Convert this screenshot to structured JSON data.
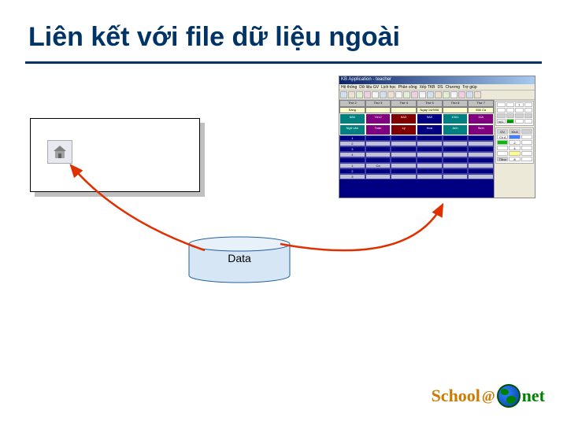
{
  "title": "Liên kết với file dữ liệu ngoài",
  "panel": {
    "icon_name": "house-icon"
  },
  "app_window": {
    "titlebar": "KB Application - teacher",
    "menu": [
      "Hệ thống",
      "Dữ liệu GV",
      "Lịch học",
      "Phân công",
      "Xếp TKB",
      "DS",
      "Chương",
      "Trợ giúp"
    ],
    "toolbar_count": 18,
    "grid": {
      "header": [
        "Thứ 2",
        "Thứ 3",
        "Thứ 4",
        "Thứ 5",
        "Thứ 6",
        "Thứ 7"
      ],
      "info": [
        "Sáng",
        "",
        "",
        "Ngày 14/9/06",
        "",
        "555 Ca"
      ],
      "colored_row1": [
        {
          "text": "6A6",
          "cls": "teal"
        },
        {
          "text": "7A12",
          "cls": "purple"
        },
        {
          "text": "8A3",
          "cls": "darkred"
        },
        {
          "text": "9A5",
          "cls": "darkblue"
        },
        {
          "text": "10A1",
          "cls": "teal"
        },
        {
          "text": "11A",
          "cls": "purple"
        }
      ],
      "colored_row2": [
        {
          "text": "Ngữ văn",
          "cls": "teal"
        },
        {
          "text": "Toán",
          "cls": "purple"
        },
        {
          "text": "Lý",
          "cls": "darkred"
        },
        {
          "text": "Hoá",
          "cls": "darkblue"
        },
        {
          "text": "Anh",
          "cls": "teal"
        },
        {
          "text": "Sinh",
          "cls": "purple"
        }
      ],
      "data_rows": [
        [
          "1",
          "",
          "",
          "",
          "",
          ""
        ],
        [
          "2",
          "",
          "",
          "",
          "",
          ""
        ],
        [
          "3",
          "",
          "",
          "",
          "",
          ""
        ],
        [
          "4",
          "",
          "",
          "",
          "",
          ""
        ],
        [
          "",
          "",
          "",
          "",
          "",
          ""
        ],
        [
          "1",
          "Ca",
          "",
          "",
          "",
          ""
        ],
        [
          "2",
          "",
          "",
          "",
          "",
          ""
        ],
        [
          "3",
          "",
          "",
          "",
          "",
          ""
        ]
      ]
    },
    "side": {
      "block1_rows": [
        [
          {
            "t": "",
            "c": ""
          },
          {
            "t": "",
            "c": ""
          },
          {
            "t": "7",
            "c": ""
          },
          {
            "t": "",
            "c": ""
          }
        ],
        [
          {
            "t": "",
            "c": ""
          },
          {
            "t": "",
            "c": ""
          },
          {
            "t": "",
            "c": ""
          },
          {
            "t": "",
            "c": ""
          }
        ],
        [
          {
            "t": "",
            "c": "head"
          },
          {
            "t": "",
            "c": "head"
          },
          {
            "t": "",
            "c": "head"
          },
          {
            "t": "",
            "c": "head"
          }
        ],
        [
          {
            "t": "6A1",
            "c": ""
          },
          {
            "t": "6A2",
            "c": "g"
          },
          {
            "t": "",
            "c": ""
          },
          {
            "t": "",
            "c": ""
          }
        ]
      ],
      "block2_rows": [
        [
          {
            "t": "GV",
            "c": "head"
          },
          {
            "t": "Khối",
            "c": "head"
          },
          {
            "t": "",
            "c": "head"
          }
        ],
        [
          {
            "t": "Cô A",
            "c": ""
          },
          {
            "t": "",
            "c": "b"
          },
          {
            "t": "",
            "c": ""
          }
        ],
        [
          {
            "t": "",
            "c": "g"
          },
          {
            "t": "2",
            "c": ""
          },
          {
            "t": "",
            "c": ""
          }
        ],
        [
          {
            "t": "",
            "c": ""
          },
          {
            "t": "4",
            "c": ""
          },
          {
            "t": "",
            "c": ""
          }
        ],
        [
          {
            "t": "",
            "c": ""
          },
          {
            "t": "",
            "c": "y"
          },
          {
            "t": "",
            "c": ""
          }
        ],
        [
          {
            "t": "Tổng",
            "c": "head"
          },
          {
            "t": "8",
            "c": ""
          },
          {
            "t": "",
            "c": ""
          }
        ]
      ]
    }
  },
  "cylinder": {
    "label": "Data"
  },
  "logo": {
    "school": "School",
    "at": "@",
    "net": "net"
  }
}
